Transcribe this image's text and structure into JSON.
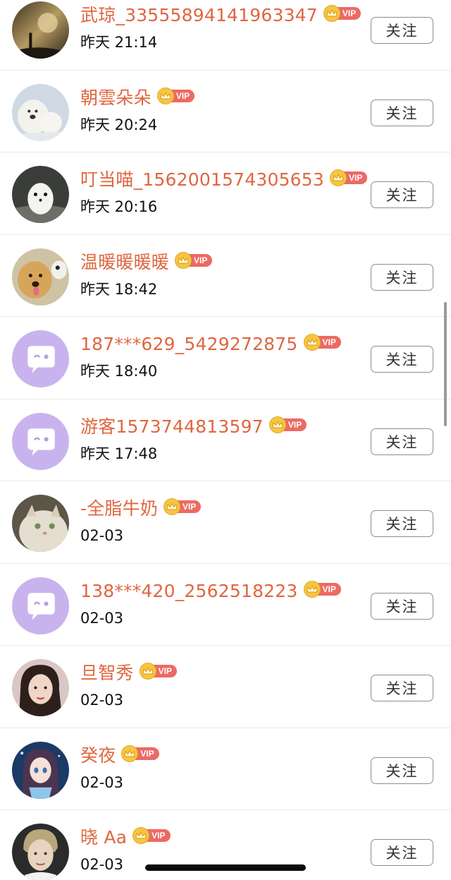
{
  "follow_label": "关注",
  "vip_label": "VIP",
  "colors": {
    "name": "#e0663f",
    "vip_badge": "#ec6a63",
    "crown": "#f6c544",
    "default_avatar": "#c9b3ee"
  },
  "users": [
    {
      "name": "武琼_33555894141963347",
      "time": "昨天 21:14",
      "avatar": "photo-dusk"
    },
    {
      "name": "朝雲朵朵",
      "time": "昨天 20:24",
      "avatar": "photo-polar-bears"
    },
    {
      "name": "叮当喵_1562001574305653",
      "time": "昨天 20:16",
      "avatar": "photo-white-ferret"
    },
    {
      "name": "温暖暖暖暖",
      "time": "昨天 18:42",
      "avatar": "photo-dog"
    },
    {
      "name": "187***629_5429272875",
      "time": "昨天 18:40",
      "avatar": "default-chat-bubble"
    },
    {
      "name": "游客1573744813597",
      "time": "昨天 17:48",
      "avatar": "default-chat-bubble"
    },
    {
      "name": "-全脂牛奶",
      "time": "02-03",
      "avatar": "photo-cat"
    },
    {
      "name": "138***420_2562518223",
      "time": "02-03",
      "avatar": "default-chat-bubble"
    },
    {
      "name": "旦智秀",
      "time": "02-03",
      "avatar": "photo-woman"
    },
    {
      "name": "癸夜",
      "time": "02-03",
      "avatar": "photo-anime-girl"
    },
    {
      "name": "晓 Aa",
      "time": "02-03",
      "avatar": "photo-man"
    }
  ]
}
